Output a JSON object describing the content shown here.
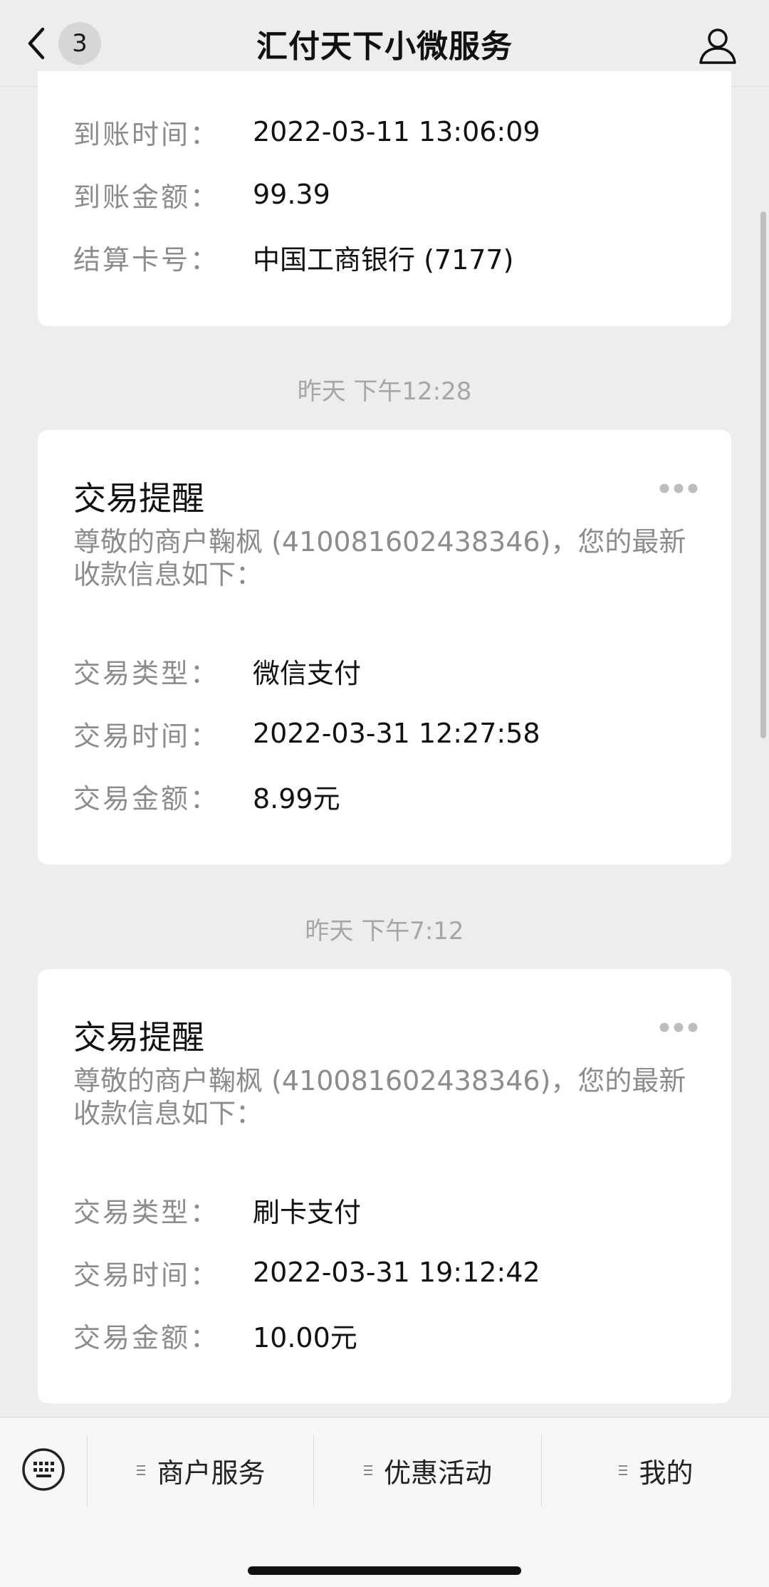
{
  "header": {
    "title": "汇付天下小微服务",
    "badge_count": "3"
  },
  "settlement_card": {
    "rows": [
      {
        "label": "到账时间：",
        "value": "2022-03-11 13:06:09"
      },
      {
        "label": "到账金额：",
        "value": "99.39"
      },
      {
        "label": "结算卡号：",
        "value": "中国工商银行 (7177)"
      }
    ]
  },
  "messages": [
    {
      "timestamp": "昨天 下午12:28",
      "title": "交易提醒",
      "desc": "尊敬的商户鞠枫 (410081602438346)，您的最新收款信息如下：",
      "rows": [
        {
          "label": "交易类型：",
          "value": "微信支付"
        },
        {
          "label": "交易时间：",
          "value": "2022-03-31 12:27:58"
        },
        {
          "label": "交易金额：",
          "value": "8.99元"
        }
      ]
    },
    {
      "timestamp": "昨天 下午7:12",
      "title": "交易提醒",
      "desc": "尊敬的商户鞠枫 (410081602438346)，您的最新收款信息如下：",
      "rows": [
        {
          "label": "交易类型：",
          "value": "刷卡支付"
        },
        {
          "label": "交易时间：",
          "value": "2022-03-31 19:12:42"
        },
        {
          "label": "交易金额：",
          "value": "10.00元"
        }
      ]
    }
  ],
  "bottom_menu": [
    {
      "label": "商户服务"
    },
    {
      "label": "优惠活动"
    },
    {
      "label": "我的"
    }
  ],
  "icons": {
    "back": "chevron-left-icon",
    "profile": "person-icon",
    "more": "ellipsis-icon",
    "keyboard": "keyboard-icon",
    "menu": "menu-lines-icon"
  },
  "colors": {
    "background": "#ededed",
    "card": "#ffffff",
    "label": "#8c8c8c",
    "timestamp": "#a6a6a6"
  }
}
